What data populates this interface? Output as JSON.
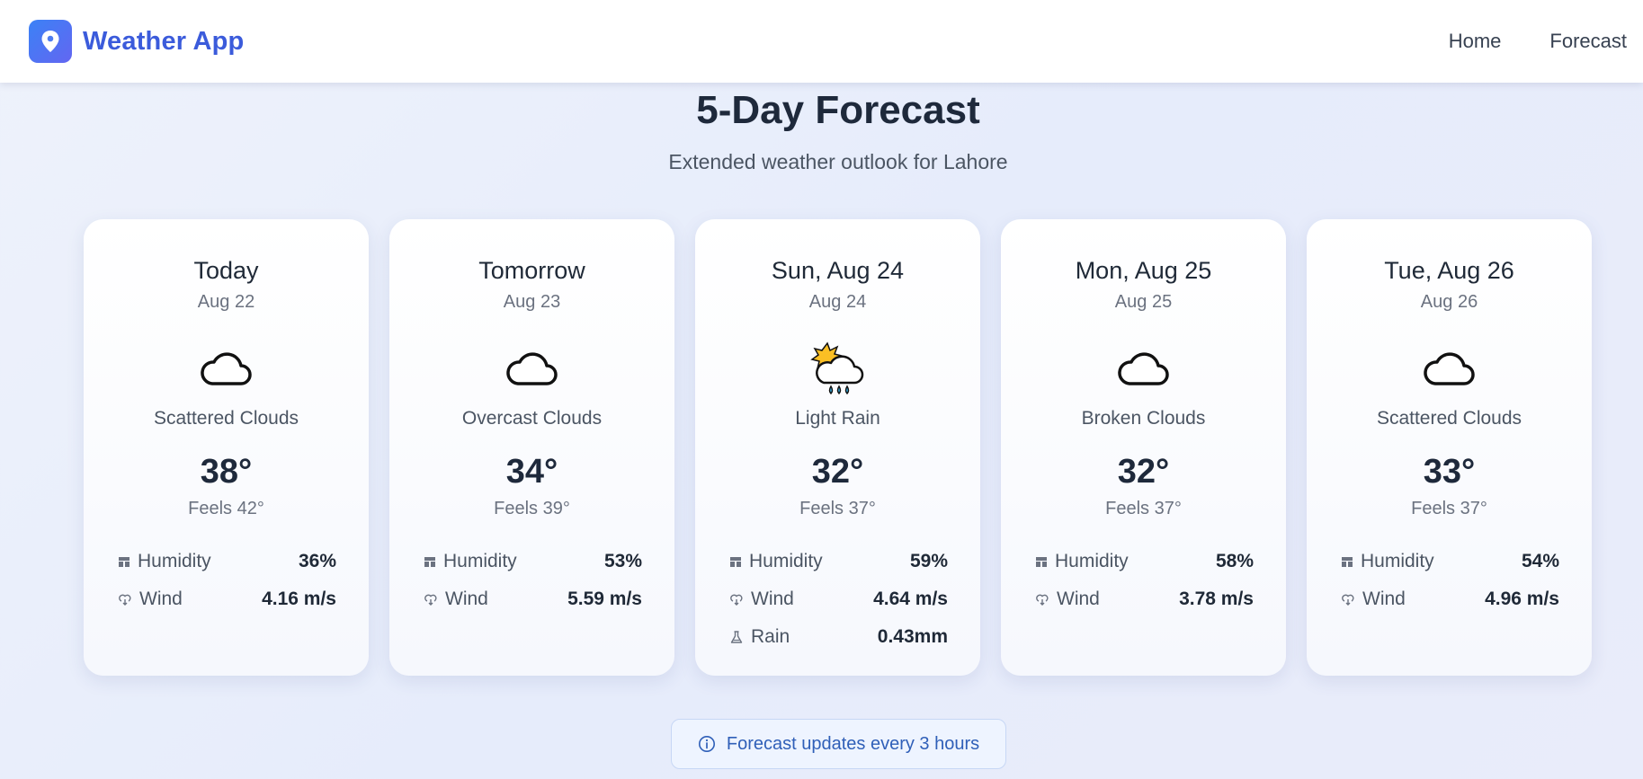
{
  "brand": {
    "name": "Weather App",
    "logo_icon": "map-pin-icon"
  },
  "nav": {
    "home": "Home",
    "forecast": "Forecast"
  },
  "page": {
    "title": "5-Day Forecast",
    "subtitle": "Extended weather outlook for Lahore"
  },
  "labels": {
    "humidity": "Humidity",
    "wind": "Wind",
    "rain": "Rain"
  },
  "cards": [
    {
      "day": "Today",
      "date": "Aug 22",
      "icon": "cloud-icon",
      "desc": "Scattered Clouds",
      "temp": "38°",
      "feels": "Feels 42°",
      "humidity": "36%",
      "wind": "4.16 m/s"
    },
    {
      "day": "Tomorrow",
      "date": "Aug 23",
      "icon": "cloud-icon",
      "desc": "Overcast Clouds",
      "temp": "34°",
      "feels": "Feels 39°",
      "humidity": "53%",
      "wind": "5.59 m/s"
    },
    {
      "day": "Sun, Aug 24",
      "date": "Aug 24",
      "icon": "sun-rain-cloud-icon",
      "desc": "Light Rain",
      "temp": "32°",
      "feels": "Feels 37°",
      "humidity": "59%",
      "wind": "4.64 m/s",
      "rain": "0.43mm"
    },
    {
      "day": "Mon, Aug 25",
      "date": "Aug 25",
      "icon": "cloud-icon",
      "desc": "Broken Clouds",
      "temp": "32°",
      "feels": "Feels 37°",
      "humidity": "58%",
      "wind": "3.78 m/s"
    },
    {
      "day": "Tue, Aug 26",
      "date": "Aug 26",
      "icon": "cloud-icon",
      "desc": "Scattered Clouds",
      "temp": "33°",
      "feels": "Feels 37°",
      "humidity": "54%",
      "wind": "4.96 m/s"
    }
  ],
  "note": {
    "text": "Forecast updates every 3 hours",
    "icon": "info-icon"
  },
  "colors": {
    "brand": "#3b5bdb",
    "accent": "#3b82f6",
    "note": "#2f5fb8"
  }
}
